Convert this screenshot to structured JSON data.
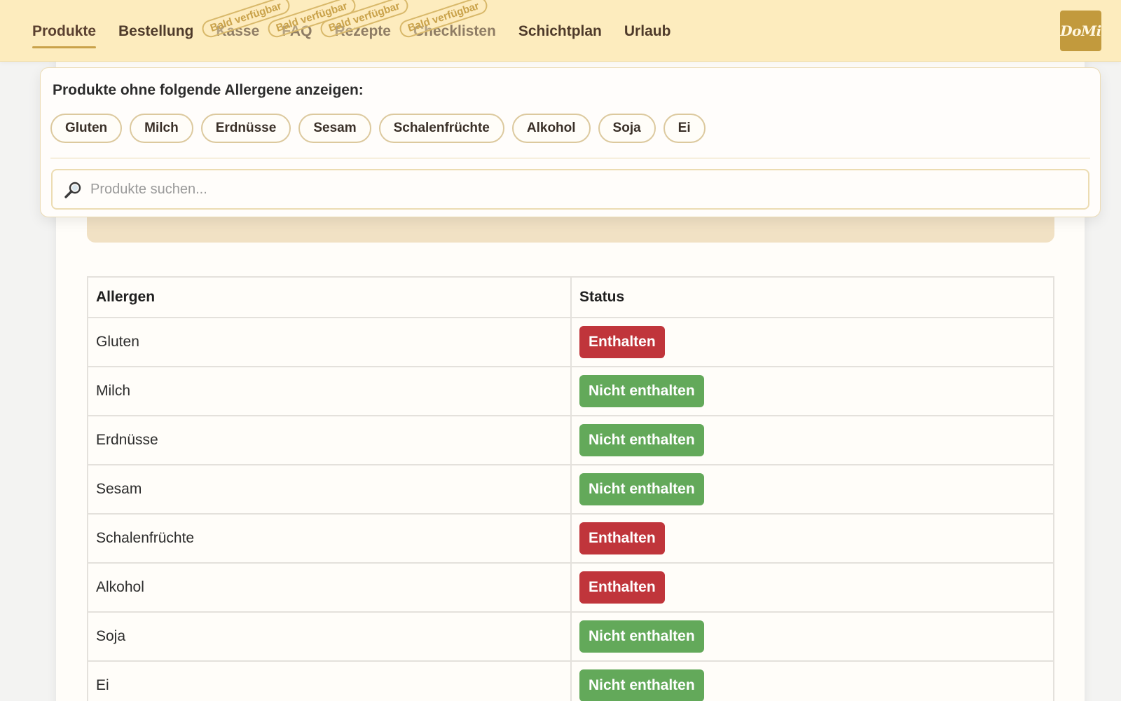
{
  "nav": {
    "items": [
      {
        "label": "Produkte",
        "active": true,
        "soon": false,
        "name": "nav-produkte"
      },
      {
        "label": "Bestellung",
        "active": false,
        "soon": false,
        "name": "nav-bestellung"
      },
      {
        "label": "Kasse",
        "active": false,
        "soon": true,
        "name": "nav-kasse"
      },
      {
        "label": "FAQ",
        "active": false,
        "soon": true,
        "name": "nav-faq"
      },
      {
        "label": "Rezepte",
        "active": false,
        "soon": true,
        "name": "nav-rezepte"
      },
      {
        "label": "Checklisten",
        "active": false,
        "soon": true,
        "name": "nav-checklisten"
      },
      {
        "label": "Schichtplan",
        "active": false,
        "soon": false,
        "name": "nav-schichtplan"
      },
      {
        "label": "Urlaub",
        "active": false,
        "soon": false,
        "name": "nav-urlaub"
      }
    ],
    "soon_label": "Bald verfügbar",
    "logo_text": "DoMi"
  },
  "filter": {
    "title": "Produkte ohne folgende Allergene anzeigen:",
    "chips": [
      "Gluten",
      "Milch",
      "Erdnüsse",
      "Sesam",
      "Schalenfrüchte",
      "Alkohol",
      "Soja",
      "Ei"
    ],
    "search_placeholder": "Produkte suchen...",
    "search_value": ""
  },
  "table": {
    "headers": {
      "allergen": "Allergen",
      "status": "Status"
    },
    "rows": [
      {
        "allergen": "Gluten",
        "status": "Enthalten",
        "contained": true
      },
      {
        "allergen": "Milch",
        "status": "Nicht enthalten",
        "contained": false
      },
      {
        "allergen": "Erdnüsse",
        "status": "Nicht enthalten",
        "contained": false
      },
      {
        "allergen": "Sesam",
        "status": "Nicht enthalten",
        "contained": false
      },
      {
        "allergen": "Schalenfrüchte",
        "status": "Enthalten",
        "contained": true
      },
      {
        "allergen": "Alkohol",
        "status": "Enthalten",
        "contained": true
      },
      {
        "allergen": "Soja",
        "status": "Nicht enthalten",
        "contained": false
      },
      {
        "allergen": "Ei",
        "status": "Nicht enthalten",
        "contained": false
      }
    ]
  },
  "colors": {
    "nav_background": "#fdecbe",
    "accent_gold": "#c9a24a",
    "status_contained": "#c0353b",
    "status_not_contained": "#63a95a"
  },
  "icons": {
    "search": "magnifier-icon"
  }
}
